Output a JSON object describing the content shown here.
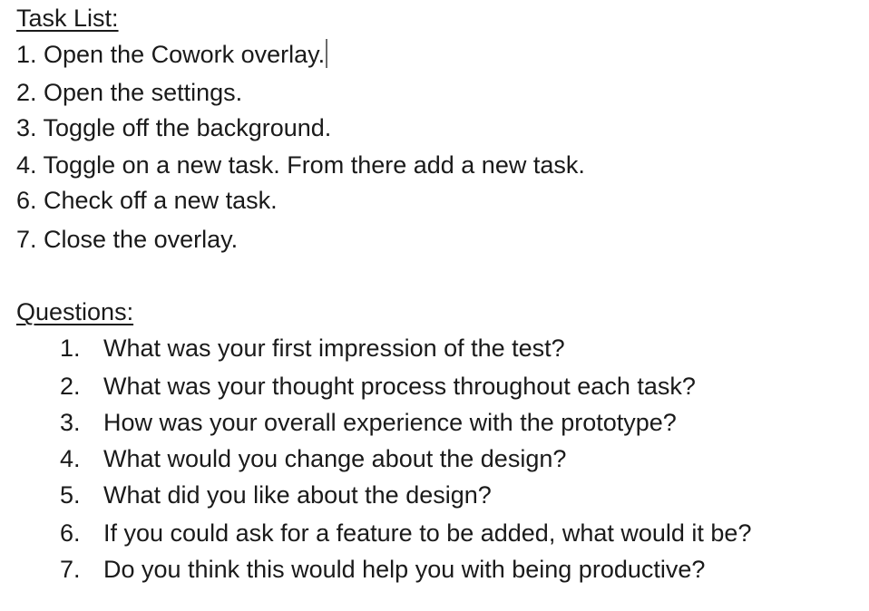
{
  "task_list": {
    "heading": "Task List:",
    "items": [
      "1. Open the Cowork overlay.",
      "2. Open the settings.",
      "3. Toggle off the background.",
      "4. Toggle on a new task. From there add a new task.",
      "6. Check off a new task.",
      "7. Close the overlay."
    ]
  },
  "questions": {
    "heading": "Questions:",
    "items": [
      {
        "num": "1.",
        "text": "What was your first impression of the test?"
      },
      {
        "num": "2.",
        "text": "What was your thought process throughout each task?"
      },
      {
        "num": "3.",
        "text": "How was your overall experience with the prototype?"
      },
      {
        "num": "4.",
        "text": "What would you change about the design?"
      },
      {
        "num": "5.",
        "text": "What did you like about the design?"
      },
      {
        "num": "6.",
        "text": "If you could ask for a feature to be added, what would it be?"
      },
      {
        "num": "7.",
        "text": "Do you think this would help you with being productive?"
      }
    ]
  }
}
